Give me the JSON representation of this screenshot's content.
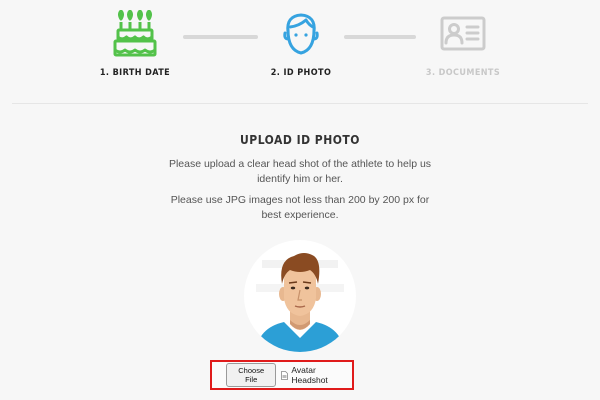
{
  "steps": [
    {
      "label": "1. BIRTH DATE",
      "icon": "birthday-cake-icon",
      "state": "complete",
      "color": "#53c24a"
    },
    {
      "label": "2. ID PHOTO",
      "icon": "person-head-icon",
      "state": "active",
      "color": "#36a3e0"
    },
    {
      "label": "3. DOCUMENTS",
      "icon": "id-card-icon",
      "state": "inactive",
      "color": "#cccccc"
    }
  ],
  "colors": {
    "text_active": "#222222",
    "text_inactive": "#c8c8c8",
    "connector": "#d8d8d8",
    "highlight": "#e01b1b"
  },
  "upload": {
    "title": "UPLOAD ID PHOTO",
    "instructions": "Please upload a clear head shot of the athlete to help us identify him or her.",
    "requirements": "Please use JPG images not less than 200 by 200 px for best experience.",
    "choose_button": "Choose File",
    "file_name": "Avatar Headshot"
  }
}
